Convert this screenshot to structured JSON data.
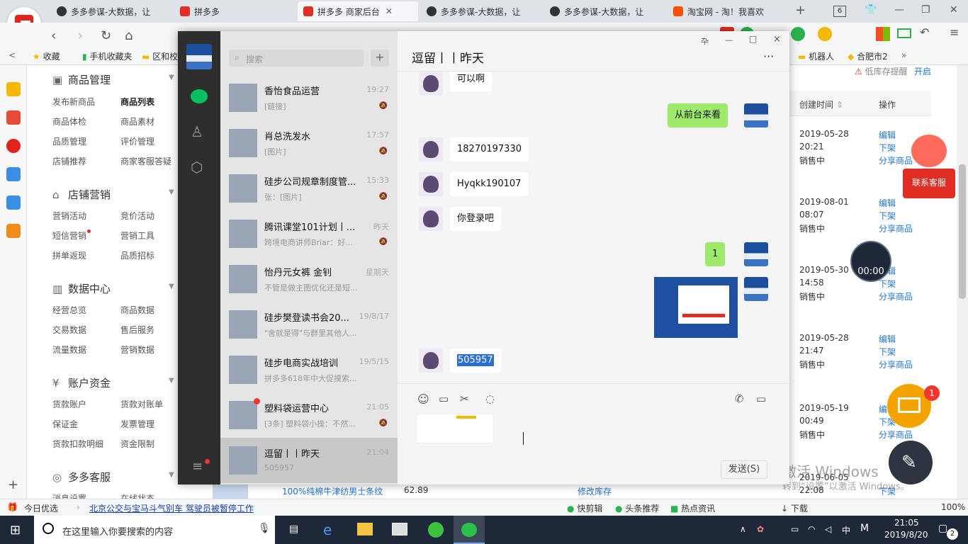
{
  "browser": {
    "tabs": [
      {
        "label": "多多参谋-大数据，让"
      },
      {
        "label": "拼多多"
      },
      {
        "label": "拼多多 商家后台"
      },
      {
        "label": "多多参谋-大数据，让"
      },
      {
        "label": "多多参谋-大数据，让"
      },
      {
        "label": "淘宝网 - 淘！我喜欢"
      }
    ],
    "tab_count": "6",
    "bookmarks": [
      {
        "label": "收藏"
      },
      {
        "label": "手机收藏夹"
      },
      {
        "label": "区和校"
      },
      {
        "label": "机器人"
      },
      {
        "label": "合肥市2"
      }
    ]
  },
  "menu": {
    "sections": [
      {
        "title": "商品管理",
        "items": [
          "发布新商品",
          "商品列表",
          "商品体检",
          "商品素材",
          "品质管理",
          "评价管理",
          "店铺推荐",
          "商家客服答疑"
        ]
      },
      {
        "title": "店铺营销",
        "items": [
          "营销活动",
          "竞价活动",
          "短信营销",
          "营销工具",
          "拼单返现",
          "品质招标"
        ]
      },
      {
        "title": "数据中心",
        "items": [
          "经营总览",
          "商品数据",
          "交易数据",
          "售后服务",
          "流量数据",
          "营销数据"
        ]
      },
      {
        "title": "账户资金",
        "items": [
          "货款账户",
          "货款对账单",
          "保证金",
          "发票管理",
          "货款扣款明细",
          "资金限制"
        ]
      },
      {
        "title": "多多客服",
        "items": [
          "消息设置",
          "在线状态"
        ]
      }
    ]
  },
  "wechat": {
    "search_placeholder": "搜索",
    "add_label": "+",
    "conversations": [
      {
        "title": "香怡食品运营",
        "preview": "[链接]",
        "time": "19:27"
      },
      {
        "title": "肖总洗发水",
        "preview": "[图片]",
        "time": "17:57"
      },
      {
        "title": "硅步公司规章制度管...",
        "preview": "张：[图片]",
        "time": "15:33"
      },
      {
        "title": "腾讯课堂101计划丨...",
        "preview": "跨境电商讲师Briar：好...",
        "time": "昨天"
      },
      {
        "title": "怡丹元女裤  金钊",
        "preview": "不管是做主图优化还是短...",
        "time": "星期天"
      },
      {
        "title": "硅步樊登读书会20...",
        "preview": "\"舍就是得\"与群里其他人...",
        "time": "19/8/17"
      },
      {
        "title": "硅步电商实战培训",
        "preview": "拼多多618年中大促摸索...",
        "time": "19/5/15"
      },
      {
        "title": "塑料袋运营中心",
        "preview": "[3条] 塑料袋小操：不然...",
        "time": "21:05"
      },
      {
        "title": "逗留丨丨昨天",
        "preview": "505957",
        "time": "21:04"
      }
    ],
    "chat_title": "逗留丨丨昨天",
    "more": "···",
    "messages": [
      {
        "text": "可以啊"
      },
      {
        "text": "从前台来看"
      },
      {
        "text": "18270197330"
      },
      {
        "text": "Hyqkk190107"
      },
      {
        "text": "你登录吧"
      },
      {
        "text": "1"
      },
      {
        "text": "505957"
      }
    ],
    "send_label": "发送(S)",
    "window_controls": [
      "卆",
      "—",
      "□",
      "×"
    ]
  },
  "table": {
    "header": {
      "created": "创建时间",
      "action": "操作"
    },
    "top_text": {
      "warn": "低库存提醒",
      "open": "开启"
    },
    "rows": [
      {
        "date": "2019-05-28",
        "time": "20:21",
        "status": "销售中",
        "edit": "编辑",
        "down": "下架",
        "share": "分享商品"
      },
      {
        "date": "2019-08-01",
        "time": "08:07",
        "status": "销售中",
        "edit": "编辑",
        "down": "下架",
        "share": "分享商品"
      },
      {
        "date": "2019-05-30",
        "time": "14:58",
        "status": "销售中",
        "edit": "编辑",
        "down": "下架",
        "share": "分享商品"
      },
      {
        "date": "2019-05-28",
        "time": "21:47",
        "status": "销售中",
        "edit": "编辑",
        "down": "下架",
        "share": "分享商品"
      },
      {
        "date": "2019-05-19",
        "time": "00:49",
        "status": "销售中",
        "edit": "编辑",
        "down": "下架",
        "share": "分享商品"
      },
      {
        "date": "2019-06-05",
        "time": "22:08",
        "status": "",
        "edit": "",
        "down": "下架",
        "share": ""
      }
    ],
    "bottom_product": "100%纯棉牛津纺男士条纹",
    "bottom_price": "62.89",
    "bottom_action": "修改库存",
    "service_label": "联系客服",
    "mail_badge": "1",
    "timer": "00:00",
    "watermark1": "激活 Windows",
    "watermark2": "转到“设置”以激活 Windows。"
  },
  "statusbar": {
    "left1": "今日优选",
    "news": "北京公交与宝马斗气别车 驾驶员被暂停工作",
    "items": [
      "快剪辑",
      "头条推荐",
      "热点资讯",
      "下载"
    ],
    "zoom": "100%"
  },
  "taskbar": {
    "search_placeholder": "在这里输入你要搜索的内容",
    "ime": "中",
    "time": "21:05",
    "date": "2019/8/20",
    "notif": "2"
  }
}
